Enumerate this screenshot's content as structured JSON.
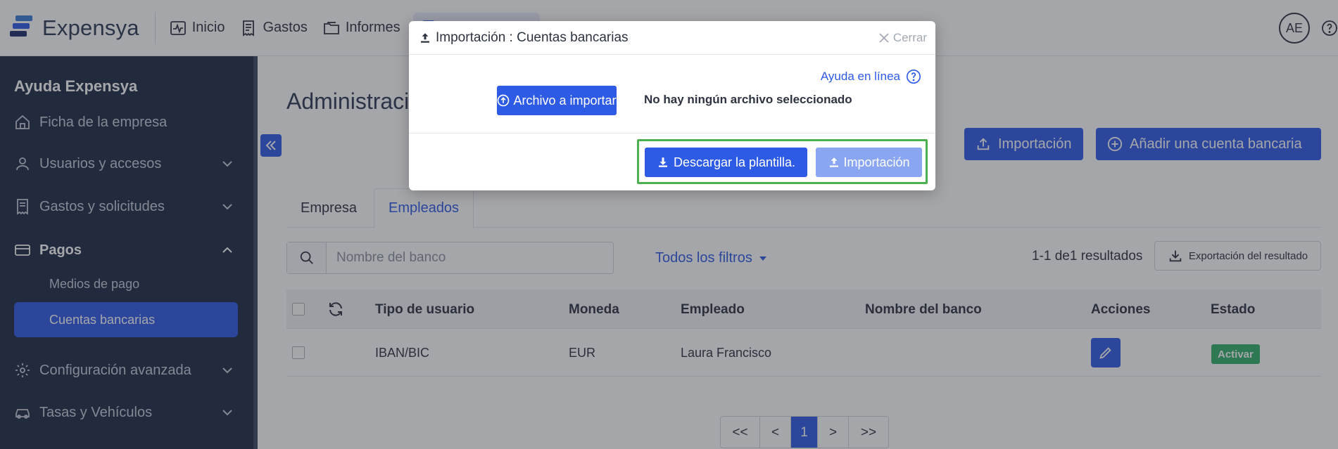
{
  "app": {
    "name": "Expensya",
    "avatar_initials": "AE"
  },
  "nav": {
    "items": [
      {
        "label": "Inicio",
        "icon": "activity-icon"
      },
      {
        "label": "Gastos",
        "icon": "receipt-icon"
      },
      {
        "label": "Informes",
        "icon": "folder-icon"
      }
    ]
  },
  "sidebar": {
    "title": "Ayuda Expensya",
    "items": [
      {
        "label": "Ficha de la empresa",
        "icon": "home-icon"
      },
      {
        "label": "Usuarios y accesos",
        "icon": "user-icon"
      },
      {
        "label": "Gastos y solicitudes",
        "icon": "receipt-icon"
      },
      {
        "label": "Pagos",
        "icon": "card-icon"
      },
      {
        "label": "Configuración avanzada",
        "icon": "gear-icon"
      },
      {
        "label": "Tasas y Vehículos",
        "icon": "car-icon"
      }
    ],
    "sub_items": [
      {
        "label": "Medios de pago"
      },
      {
        "label": "Cuentas bancarias"
      }
    ]
  },
  "main": {
    "page_title": "Administraci",
    "import_button": "Importación",
    "add_button": "Añadir una cuenta bancaria",
    "tabs": [
      "Empresa",
      "Empleados"
    ],
    "search_placeholder": "Nombre del banco",
    "filters_label": "Todos los filtros",
    "results_text": "1-1 de1 resultados",
    "export_label": "Exportación del resultado",
    "table": {
      "columns": [
        "Tipo de usuario",
        "Moneda",
        "Empleado",
        "Nombre del banco",
        "Acciones",
        "Estado"
      ],
      "rows": [
        {
          "tipo": "IBAN/BIC",
          "moneda": "EUR",
          "empleado": "Laura Francisco",
          "banco": "",
          "estado": "Activar"
        }
      ]
    },
    "pagination": [
      "<<",
      "<",
      "1",
      ">",
      ">>"
    ]
  },
  "modal": {
    "title": "Importación : Cuentas bancarias",
    "close_label": "Cerrar",
    "help_link": "Ayuda en línea",
    "file_button": "Archivo a importar",
    "file_status": "No hay ningún archivo seleccionado",
    "download_button": "Descargar la plantilla.",
    "import_button": "Importación"
  },
  "colors": {
    "primary": "#2e5be6",
    "sidebar_bg": "#1d2b44",
    "success": "#33b06a",
    "highlight": "#4caf50"
  }
}
